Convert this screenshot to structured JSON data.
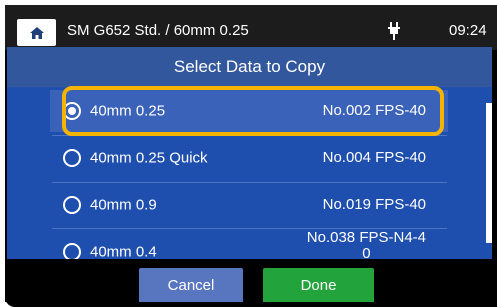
{
  "header": {
    "title": "SM G652 Std. / 60mm 0.25",
    "time": "09:24",
    "home_icon": "home-icon",
    "power_icon": "plug-icon"
  },
  "dialog": {
    "title": "Select Data to Copy",
    "options": [
      {
        "label": "40mm 0.25",
        "code": "No.002 FPS-40",
        "selected": true
      },
      {
        "label": "40mm 0.25 Quick",
        "code": "No.004 FPS-40",
        "selected": false
      },
      {
        "label": "40mm 0.9",
        "code": "No.019 FPS-40",
        "selected": false
      },
      {
        "label": "40mm 0.4",
        "code_line1": "No.038 FPS-N4-4",
        "code_line2": "0",
        "selected": false
      }
    ]
  },
  "buttons": {
    "cancel_label": "Cancel",
    "done_label": "Done"
  },
  "colors": {
    "highlight": "#f4b400",
    "done": "#22a33b",
    "cancel": "#5876c0",
    "list_bg": "#1f4fae"
  }
}
